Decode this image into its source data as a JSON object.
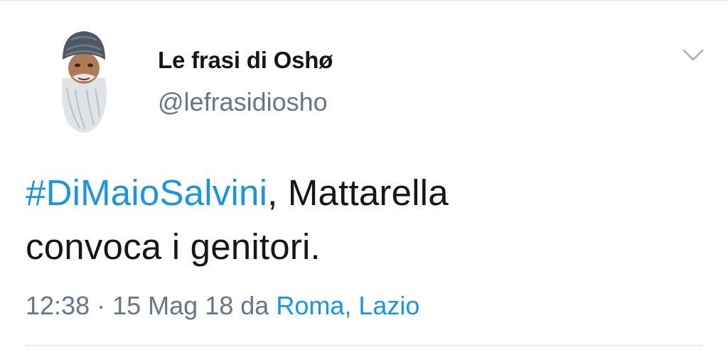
{
  "author": {
    "display_name": "Le frasi di Oshø",
    "handle": "@lefrasidiosho",
    "avatar_icon": "bearded-man-avatar-icon"
  },
  "tweet": {
    "hashtag": "#DiMaioSalvini",
    "text_line1_rest": ", Mattarella",
    "text_line2": "convoca i genitori."
  },
  "meta": {
    "time": "12:38",
    "separator": "·",
    "date": "15 Mag 18",
    "from_label": "da",
    "location": "Roma, Lazio"
  },
  "icons": {
    "menu": "chevron-down-icon"
  },
  "colors": {
    "link": "#1b95e0",
    "text": "#14171a",
    "secondary": "#657786",
    "divider": "#e6ecf0"
  }
}
